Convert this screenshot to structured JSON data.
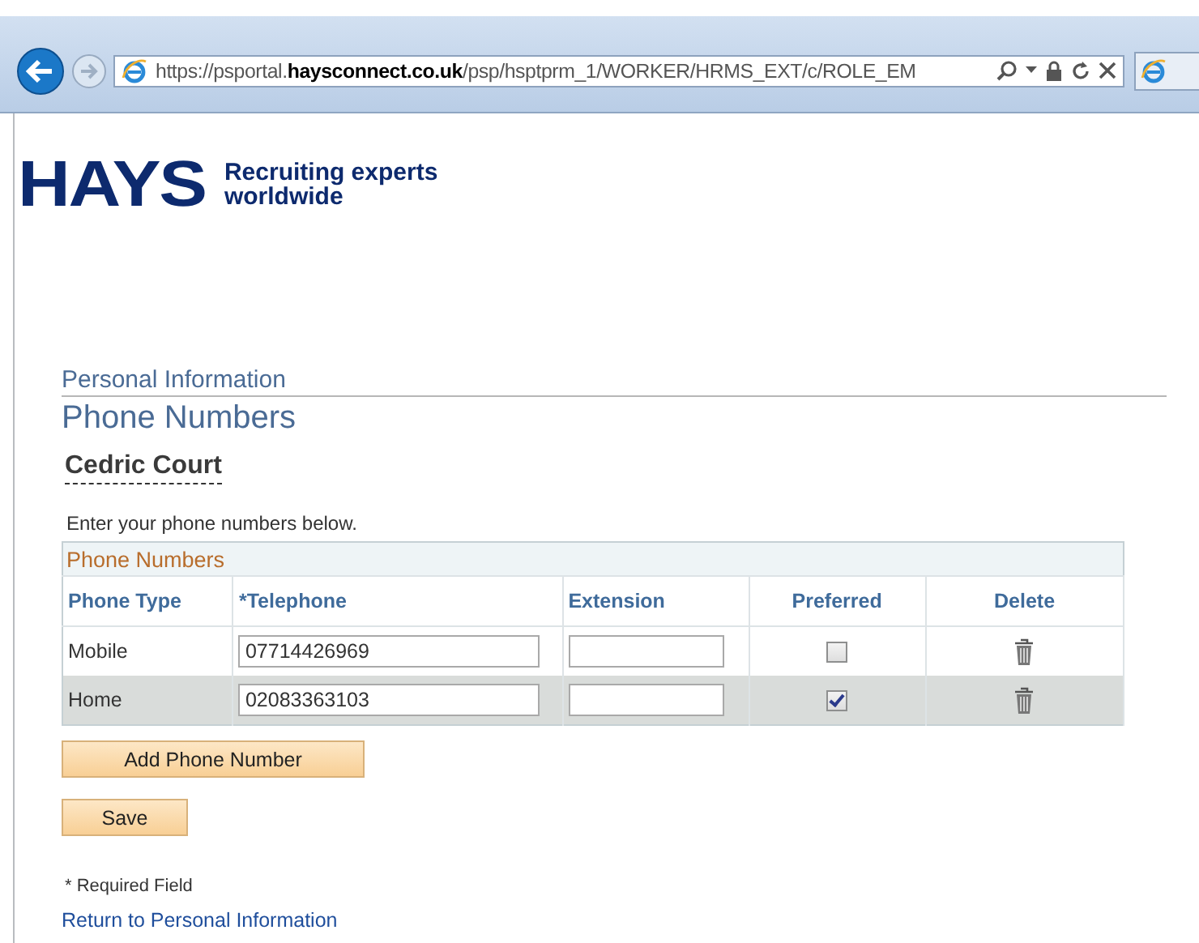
{
  "browser": {
    "address": "https://psportal.**haysconnect.co.uk**/psp/hsptprm_1/WORKER/HRMS_EXT/c/ROLE_EM"
  },
  "logo": {
    "wordmark": "HAYS",
    "tagline": [
      "Recruiting experts",
      "worldwide"
    ]
  },
  "breadcrumb": "Personal Information",
  "page_title": "Phone Numbers",
  "person_name": "Cedric Court",
  "instructions": "Enter your phone numbers below.",
  "table": {
    "title": "Phone Numbers",
    "columns": [
      "Phone Type",
      "*Telephone",
      "Extension",
      "Preferred",
      "Delete"
    ],
    "rows": [
      {
        "phone_type": "Mobile",
        "telephone": "07714426969",
        "preferred": false
      },
      {
        "phone_type": "Home",
        "telephone": "02083363103",
        "preferred": true
      }
    ]
  },
  "buttons": [
    "Add Phone Number",
    "Save"
  ],
  "required_note": "* Required Field",
  "return_link": "Return to Personal Information"
}
